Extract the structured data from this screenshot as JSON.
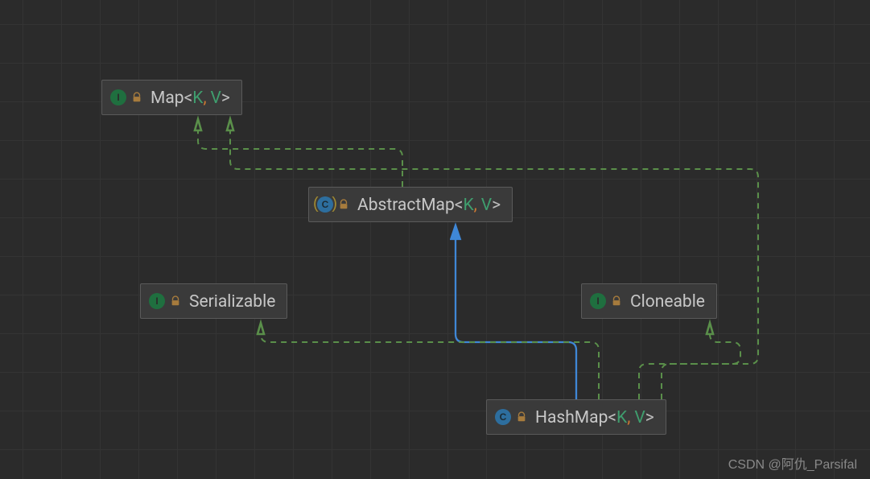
{
  "watermark": "CSDN @阿仇_Parsifal",
  "badges": {
    "interface": "I",
    "class": "C"
  },
  "nodes": {
    "map": {
      "kind": "interface",
      "name": "Map",
      "type_params": [
        "K",
        "V"
      ]
    },
    "abstractMap": {
      "kind": "abstract-class",
      "name": "AbstractMap",
      "type_params": [
        "K",
        "V"
      ]
    },
    "serializable": {
      "kind": "interface",
      "name": "Serializable",
      "type_params": []
    },
    "cloneable": {
      "kind": "interface",
      "name": "Cloneable",
      "type_params": []
    },
    "hashMap": {
      "kind": "class",
      "name": "HashMap",
      "type_params": [
        "K",
        "V"
      ]
    }
  },
  "edges": [
    {
      "from": "abstractMap",
      "to": "map",
      "kind": "implements"
    },
    {
      "from": "hashMap",
      "to": "abstractMap",
      "kind": "extends"
    },
    {
      "from": "hashMap",
      "to": "map",
      "kind": "implements"
    },
    {
      "from": "hashMap",
      "to": "serializable",
      "kind": "implements"
    },
    {
      "from": "hashMap",
      "to": "cloneable",
      "kind": "implements"
    }
  ],
  "style": {
    "implements_color": "#5a8f4a",
    "extends_color": "#3f87d6",
    "node_bg": "#3a3a3a",
    "node_border": "#5a5a5a",
    "grid_bg": "#2b2b2b",
    "type_param_color": "#3f9e6e",
    "punctuation_color": "#cc7832"
  }
}
